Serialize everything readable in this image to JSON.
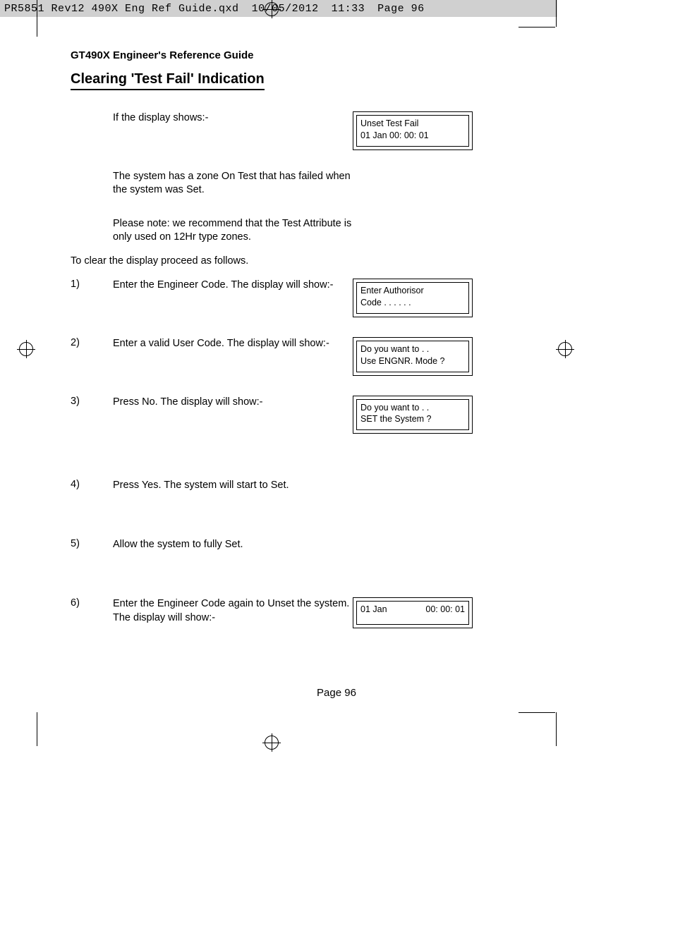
{
  "slug": {
    "filename": "PR5851 Rev12 490X Eng Ref Guide.qxd",
    "date": "10/05/2012",
    "time": "11:33",
    "page_label": "Page 96"
  },
  "header": {
    "running_head": "GT490X Engineer's Reference Guide",
    "section_title": "Clearing 'Test Fail' Indication"
  },
  "intro": {
    "line1": "If the display shows:-",
    "para2": "The system has a zone On Test that has failed when the system was Set.",
    "para3": "Please note: we recommend that the Test Attribute is only used on 12Hr type zones.",
    "lead": "To clear the display proceed as follows."
  },
  "steps": [
    {
      "num": "1)",
      "text": "Enter the Engineer Code. The display will show:-"
    },
    {
      "num": "2)",
      "text": "Enter a valid User Code. The display will show:-"
    },
    {
      "num": "3)",
      "text": "Press No. The display will show:-"
    },
    {
      "num": "4)",
      "text": "Press Yes. The system will start to Set."
    },
    {
      "num": "5)",
      "text": "Allow the system to fully Set."
    },
    {
      "num": "6)",
      "text": "Enter the Engineer Code again to Unset the system. The display will show:-"
    }
  ],
  "displays": {
    "d0": {
      "l1": "Unset Test Fail",
      "l2": "01 Jan 00: 00: 01"
    },
    "d1": {
      "l1": "Enter Authorisor",
      "l2": "Code . . . . . ."
    },
    "d2": {
      "l1": "Do you want to . .",
      "l2": "Use ENGNR. Mode ?"
    },
    "d3": {
      "l1": "Do you want to . .",
      "l2": "SET the System ?"
    },
    "d6": {
      "l1": "",
      "l2a": "01 Jan",
      "l2b": "00: 00: 01"
    }
  },
  "footer": {
    "page_label": "Page  96"
  }
}
